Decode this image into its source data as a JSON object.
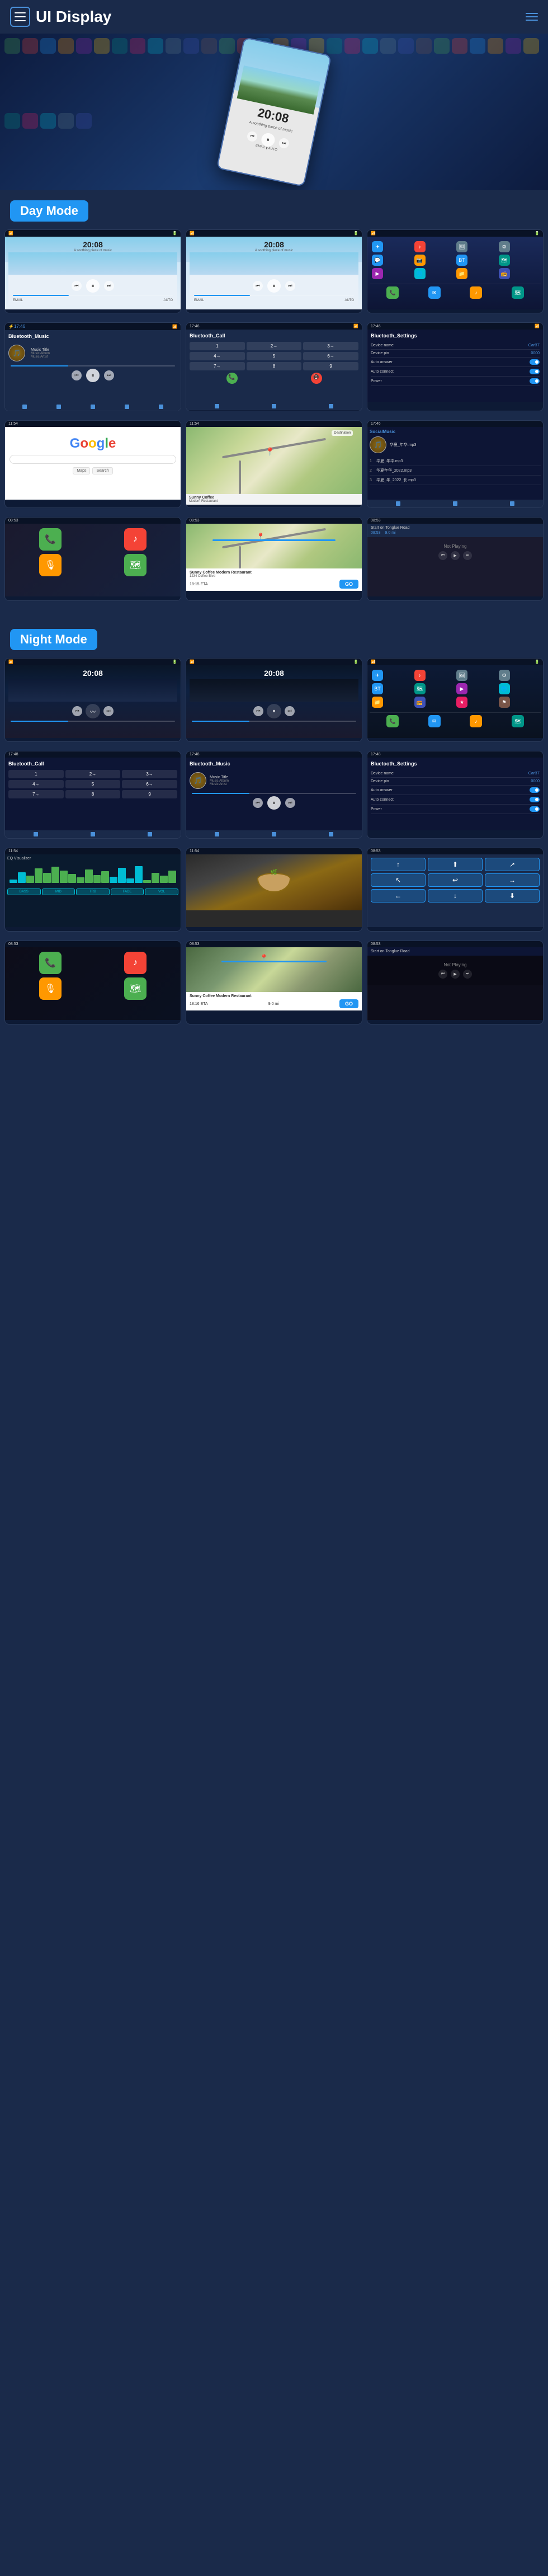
{
  "header": {
    "title": "UI Display",
    "menu_icon_label": "menu",
    "lines_icon_label": "lines"
  },
  "day_mode": {
    "label": "Day Mode",
    "screenshots": [
      {
        "id": "day-music-1",
        "type": "music",
        "time": "20:08",
        "subtitle": "A soothing piece of music"
      },
      {
        "id": "day-music-2",
        "type": "music",
        "time": "20:08",
        "subtitle": "A soothing piece of music"
      },
      {
        "id": "day-apps",
        "type": "apps",
        "label": "App Grid"
      },
      {
        "id": "day-bluetooth-music",
        "type": "bluetooth",
        "title": "Bluetooth_Music",
        "tracks": [
          "Music Title",
          "Music Album",
          "Music Artist"
        ]
      },
      {
        "id": "day-bluetooth-call",
        "type": "phone",
        "title": "Bluetooth_Call"
      },
      {
        "id": "day-bluetooth-settings",
        "type": "settings",
        "title": "Bluetooth_Settings",
        "settings": [
          {
            "label": "Device name",
            "value": "CarBT"
          },
          {
            "label": "Device pin",
            "value": "0000"
          },
          {
            "label": "Auto answer",
            "value": "toggle"
          },
          {
            "label": "Auto connect",
            "value": "toggle"
          },
          {
            "label": "Power",
            "value": "toggle"
          }
        ]
      },
      {
        "id": "day-google",
        "type": "google",
        "logo": "Google"
      },
      {
        "id": "day-map",
        "type": "map"
      },
      {
        "id": "day-social",
        "type": "social",
        "title": "SocialMusic",
        "songs": [
          {
            "title": "华夏_年华.mp3"
          },
          {
            "title": "华夏年华_2022.mp3"
          },
          {
            "title": "华夏_年_2022_长.mp3"
          }
        ]
      },
      {
        "id": "day-carplay-apps",
        "type": "carplay-apps",
        "label": "CarPlay Apps"
      },
      {
        "id": "day-nav-route",
        "type": "nav-route",
        "destination": "Sunny Coffee Modern Restaurant",
        "address": "1234 Coffee Blvd",
        "eta": "18:15 ETA",
        "distance": "9.0 mi"
      },
      {
        "id": "day-nav-turn",
        "type": "nav-turn",
        "instruction": "Start on Tonglue Road",
        "time": "08:53",
        "distance": "9.0 mi",
        "status": "Not Playing"
      }
    ]
  },
  "night_mode": {
    "label": "Night Mode",
    "screenshots": [
      {
        "id": "night-music-1",
        "type": "music-night",
        "time": "20:08"
      },
      {
        "id": "night-music-2",
        "type": "music-night",
        "time": "20:08"
      },
      {
        "id": "night-apps",
        "type": "apps-night",
        "label": "Night Apps"
      },
      {
        "id": "night-bluetooth-call",
        "type": "phone-night",
        "title": "Bluetooth_Call"
      },
      {
        "id": "night-bluetooth-music",
        "type": "bluetooth-night",
        "title": "Bluetooth_Music",
        "tracks": [
          "Music Title",
          "Music Album",
          "Music Artist"
        ]
      },
      {
        "id": "night-settings",
        "type": "settings-night",
        "title": "Bluetooth_Settings",
        "settings": [
          {
            "label": "Device name",
            "value": "CarBT"
          },
          {
            "label": "Device pin",
            "value": "0000"
          },
          {
            "label": "Auto answer",
            "value": "toggle"
          },
          {
            "label": "Auto connect",
            "value": "toggle"
          },
          {
            "label": "Power",
            "value": "toggle"
          }
        ]
      },
      {
        "id": "night-waveform",
        "type": "waveform"
      },
      {
        "id": "night-food",
        "type": "food-image"
      },
      {
        "id": "night-nav-arrows",
        "type": "nav-arrows"
      },
      {
        "id": "night-carplay-apps",
        "type": "carplay-apps-night"
      },
      {
        "id": "night-nav-route",
        "type": "nav-route-night",
        "destination": "Sunny Coffee Modern Restaurant",
        "eta": "18:16 ETA",
        "distance": "9.0 mi"
      },
      {
        "id": "night-nav-turn",
        "type": "nav-turn-night",
        "instruction": "Start on Tonglue Road",
        "status": "Not Playing"
      }
    ]
  },
  "app_colors": {
    "phone": "#4CAF50",
    "messages": "#4CAF50",
    "music": "#FF9800",
    "maps": "#4CAF50",
    "settings": "#607D8B",
    "camera": "#9C27B0",
    "telegram": "#2196F3",
    "youtube": "#f44336",
    "netflix": "#f44336",
    "spotify": "#4CAF50",
    "waze": "#00BCD4",
    "bt": "#2196F3"
  }
}
